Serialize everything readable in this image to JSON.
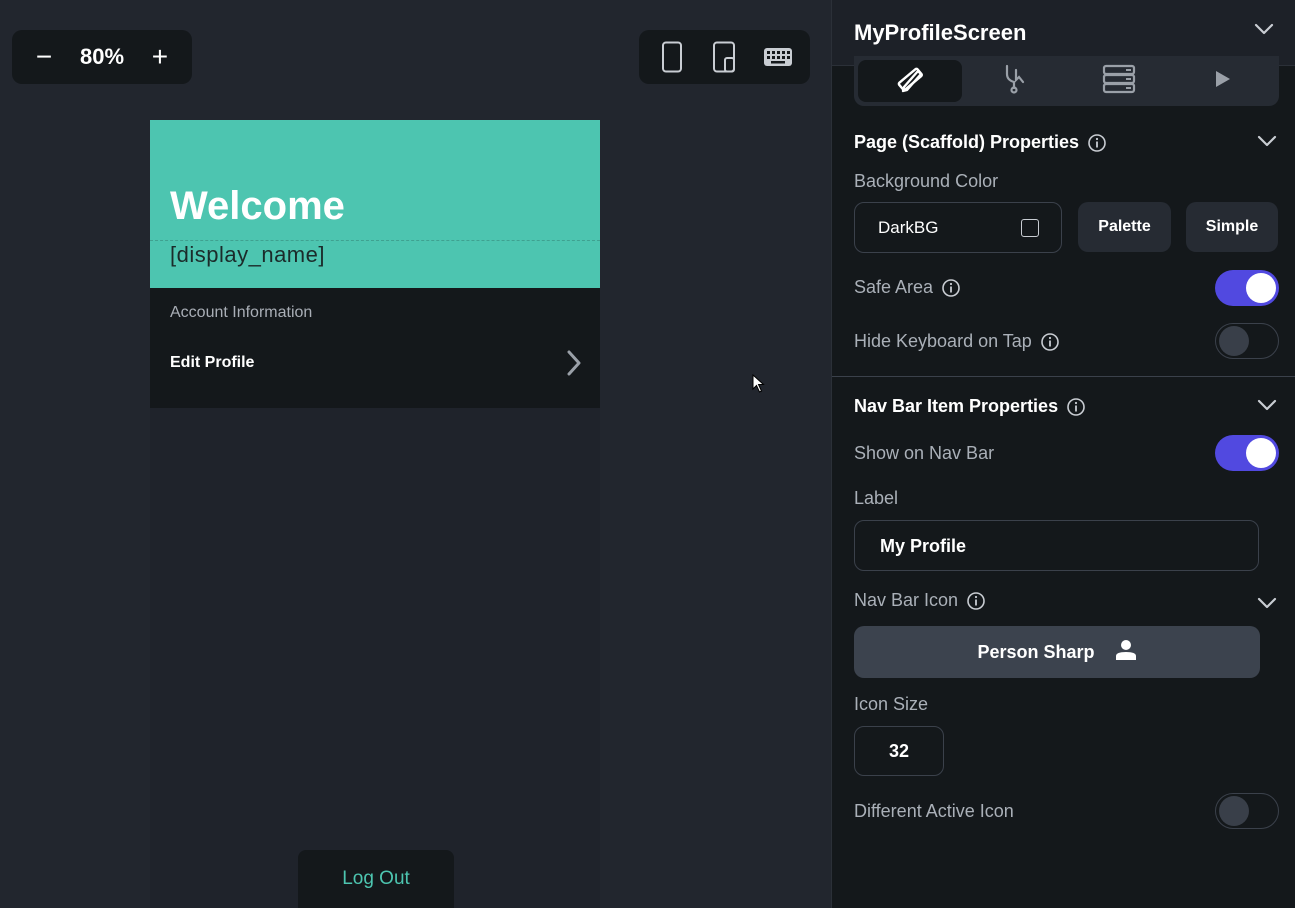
{
  "canvas": {
    "zoom": {
      "minus_label": "−",
      "value": "80%",
      "plus_label": "+"
    },
    "devices": [
      "phone-icon",
      "tablet-icon",
      "keyboard-icon"
    ]
  },
  "phone": {
    "header_color": "#4dc5b0",
    "welcome": "Welcome",
    "display_name": "[display_name]",
    "account_title": "Account Information",
    "edit_profile": "Edit Profile",
    "logout": "Log Out"
  },
  "panel": {
    "title": "MyProfileScreen",
    "tabs": [
      "design-icon",
      "branch-icon",
      "database-icon",
      "play-icon"
    ],
    "page_section": {
      "title": "Page (Scaffold) Properties",
      "background_color_label": "Background Color",
      "background_color_value": "DarkBG",
      "palette_label": "Palette",
      "simple_label": "Simple",
      "safe_area_label": "Safe Area",
      "hide_keyboard_label": "Hide Keyboard on Tap"
    },
    "nav_section": {
      "title": "Nav Bar Item Properties",
      "show_on_nav_label": "Show on Nav Bar",
      "label_label": "Label",
      "label_value": "My Profile",
      "nav_icon_label": "Nav Bar Icon",
      "nav_icon_value": "Person Sharp",
      "icon_size_label": "Icon Size",
      "icon_size_value": "32",
      "different_active_label": "Different Active Icon"
    },
    "accent": "#5149e0"
  }
}
